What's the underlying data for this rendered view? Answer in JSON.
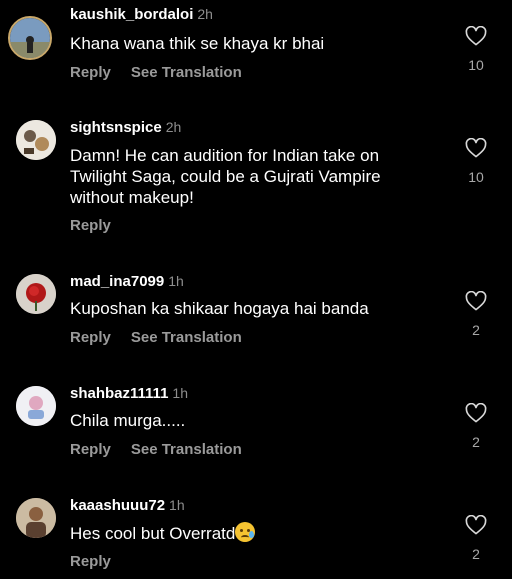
{
  "comments": [
    {
      "username": "kaushik_bordaloi",
      "time": "2h",
      "text": "Khana wana thik se khaya kr bhai",
      "reply": "Reply",
      "see_translation": "See Translation",
      "likes": "10",
      "avatar_icon": "user-avatar-circle-outlined"
    },
    {
      "username": "sightsnspice",
      "time": "2h",
      "text": "Damn! He can audition for Indian take on Twilight Saga, could be a Gujrati Vampire without makeup!",
      "reply": "Reply",
      "likes": "10",
      "avatar_icon": "user-avatar"
    },
    {
      "username": "mad_ina7099",
      "time": "1h",
      "text": "Kuposhan ka shikaar hogaya hai banda",
      "reply": "Reply",
      "see_translation": "See Translation",
      "likes": "2",
      "avatar_icon": "user-avatar-rose"
    },
    {
      "username": "shahbaz11111",
      "time": "1h",
      "text": "Chila murga.....",
      "reply": "Reply",
      "see_translation": "See Translation",
      "likes": "2",
      "avatar_icon": "user-avatar"
    },
    {
      "username": "kaaashuuu72",
      "time": "1h",
      "text": "Hes cool but Overratd",
      "emoji": "crying-face",
      "reply": "Reply",
      "likes": "2",
      "avatar_icon": "user-avatar"
    }
  ],
  "colors": {
    "background": "#000000",
    "text": "#ffffff",
    "muted": "#8e8e8e"
  }
}
